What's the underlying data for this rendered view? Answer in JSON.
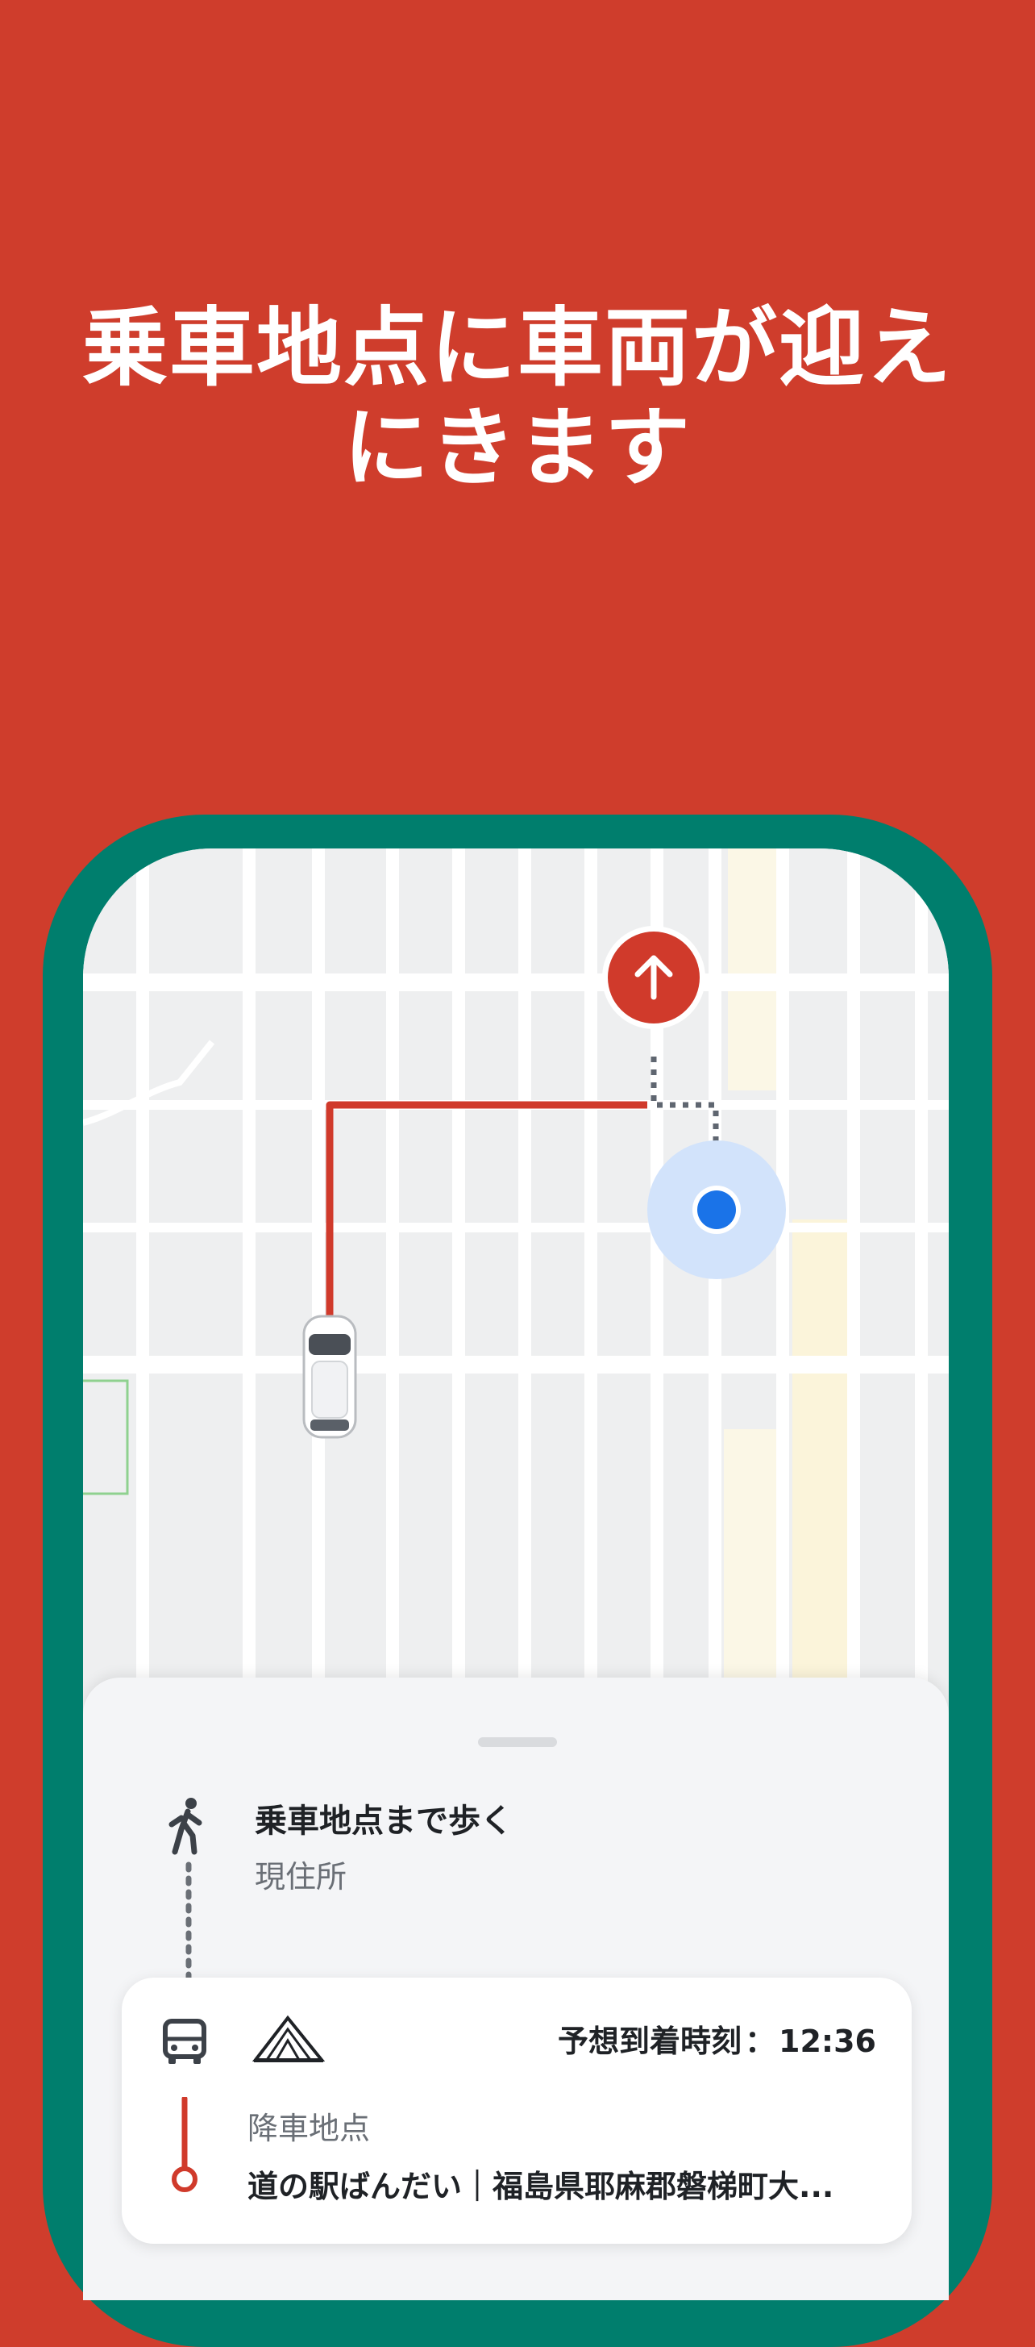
{
  "headline": {
    "line1": "乗車地点に車両が迎え",
    "line2": "にきます"
  },
  "colors": {
    "background": "#cf3d2c",
    "phone_frame": "#007e6d",
    "route": "#d03a2b",
    "user_location": "#1a73e8"
  },
  "map": {
    "pickup_marker_icon": "arrow-up-icon",
    "vehicle_icon": "car-icon",
    "user_location_icon": "location-dot-icon"
  },
  "sheet": {
    "walk": {
      "icon": "pedestrian-icon",
      "title": "乗車地点まで歩く",
      "subtitle": "現住所"
    },
    "ride": {
      "vehicle_icon": "bus-icon",
      "operator_logo": "mountain-logo-icon",
      "eta_label": "予想到着時刻",
      "eta_separator": "：",
      "eta_time": "12:36",
      "dropoff_label": "降車地点",
      "dropoff_address": "道の駅ばんだい｜福島県耶麻郡磐梯町大..."
    }
  }
}
